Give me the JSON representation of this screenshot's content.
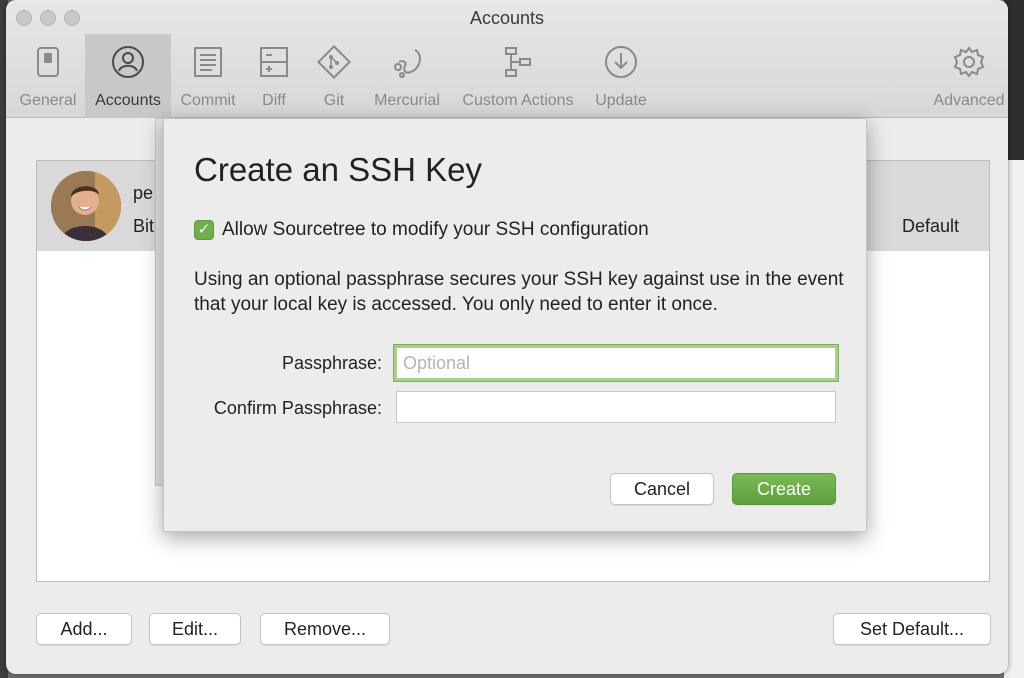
{
  "window": {
    "title": "Accounts"
  },
  "toolbar": {
    "items": [
      {
        "label": "General",
        "icon": "switch-icon"
      },
      {
        "label": "Accounts",
        "icon": "user-circle-icon",
        "active": true
      },
      {
        "label": "Commit",
        "icon": "document-lines-icon"
      },
      {
        "label": "Diff",
        "icon": "diff-icon"
      },
      {
        "label": "Git",
        "icon": "git-icon"
      },
      {
        "label": "Mercurial",
        "icon": "mercurial-icon"
      },
      {
        "label": "Custom Actions",
        "icon": "custom-actions-icon"
      },
      {
        "label": "Update",
        "icon": "download-circle-icon"
      },
      {
        "label": "Advanced",
        "icon": "gear-icon"
      }
    ]
  },
  "accounts": {
    "row": {
      "name": "pe",
      "host": "Bit",
      "status": "Default"
    }
  },
  "buttons": {
    "add": "Add...",
    "edit": "Edit...",
    "remove": "Remove...",
    "set_default": "Set Default..."
  },
  "dialog": {
    "title": "Create an SSH Key",
    "allow_label": "Allow Sourcetree to modify your SSH configuration",
    "allow_checked": true,
    "description": "Using an optional passphrase secures your SSH key against use in the event that your local key is accessed. You only need to enter it once.",
    "passphrase_label": "Passphrase:",
    "passphrase_placeholder": "Optional",
    "passphrase_value": "",
    "confirm_label": "Confirm Passphrase:",
    "confirm_value": "",
    "cancel": "Cancel",
    "create": "Create"
  },
  "colors": {
    "accent_green": "#6fae4a",
    "focus_ring": "#a9cf8f"
  }
}
